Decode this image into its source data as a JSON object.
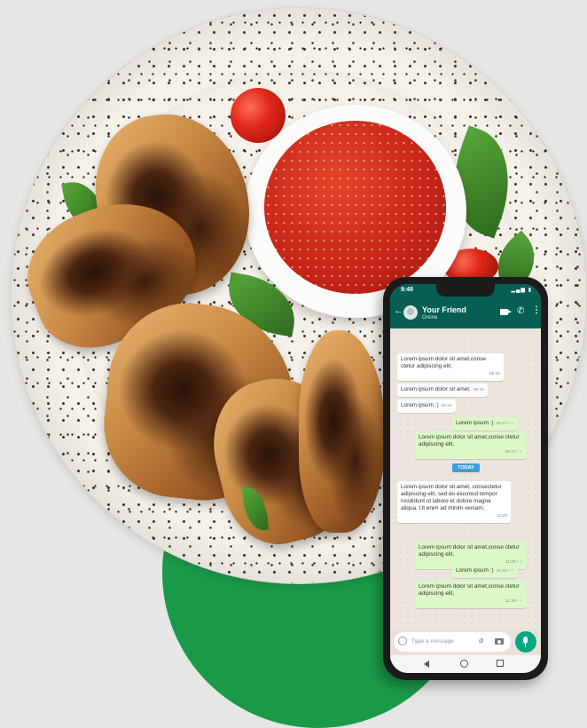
{
  "phone": {
    "status_time": "9:48",
    "header": {
      "contact_name": "Your Friend",
      "contact_status": "Online",
      "icons": [
        "back-arrow-icon",
        "avatar",
        "video-call-icon",
        "phone-icon",
        "more-vert-icon"
      ]
    },
    "messages": [
      {
        "dir": "in",
        "text": "Lorem ipsum dolor sit amet,conse ctetur adipiscing elit,",
        "time": "08:25"
      },
      {
        "dir": "in",
        "text": "Lorem ipsum dolor sit amet,",
        "time": "08:26"
      },
      {
        "dir": "in",
        "text": "Lorem ipsum :)",
        "time": "08:26"
      },
      {
        "dir": "out",
        "text": "Lorem ipsum :)",
        "time": "08:27"
      },
      {
        "dir": "out",
        "text": "Lorem ipsum dolor sit amet,conse ctetur adipiscing elit,",
        "time": "08:27"
      },
      {
        "dir": "in",
        "text": "Lorem ipsum dolor sit amet, consectetur adipiscing elit, sed do eiusmod tempor incididunt ut labore et dolore magna aliqua. Ut enim ad minim veniam,",
        "time": "11:28"
      },
      {
        "dir": "out",
        "text": "Lorem ipsum dolor sit amet,conse ctetur adipiscing elit,",
        "time": "11:28"
      },
      {
        "dir": "out",
        "text": "Lorem ipsum :)",
        "time": "11:28"
      },
      {
        "dir": "out",
        "text": "Lorem ipsum dolor sit amet,conse ctetur adipiscing elit,",
        "time": "11:28"
      }
    ],
    "date_divider": "TODAY",
    "input": {
      "placeholder": "Type a message"
    },
    "colors": {
      "header": "#075e54",
      "outgoing": "#dcf8c6",
      "incoming": "#ffffff",
      "accent": "#00a884"
    }
  },
  "background": {
    "brand_circle_color": "#1a9a48"
  }
}
